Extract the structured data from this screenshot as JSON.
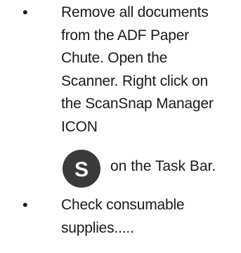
{
  "bullets": [
    {
      "symbol": "•",
      "text": "Remove all documents\nfrom the ADF Paper\nChute.  Open the\nScanner. Right click on\nthe ScanSnap Manager\nICON"
    },
    {
      "symbol": "•",
      "text": "Check consumable\nsupplies....."
    }
  ],
  "icon_row": {
    "icon": "scansnap-s-icon",
    "icon_letter": "S",
    "icon_bg_color": "#3a3a3a",
    "caption": "on the Task Bar."
  }
}
